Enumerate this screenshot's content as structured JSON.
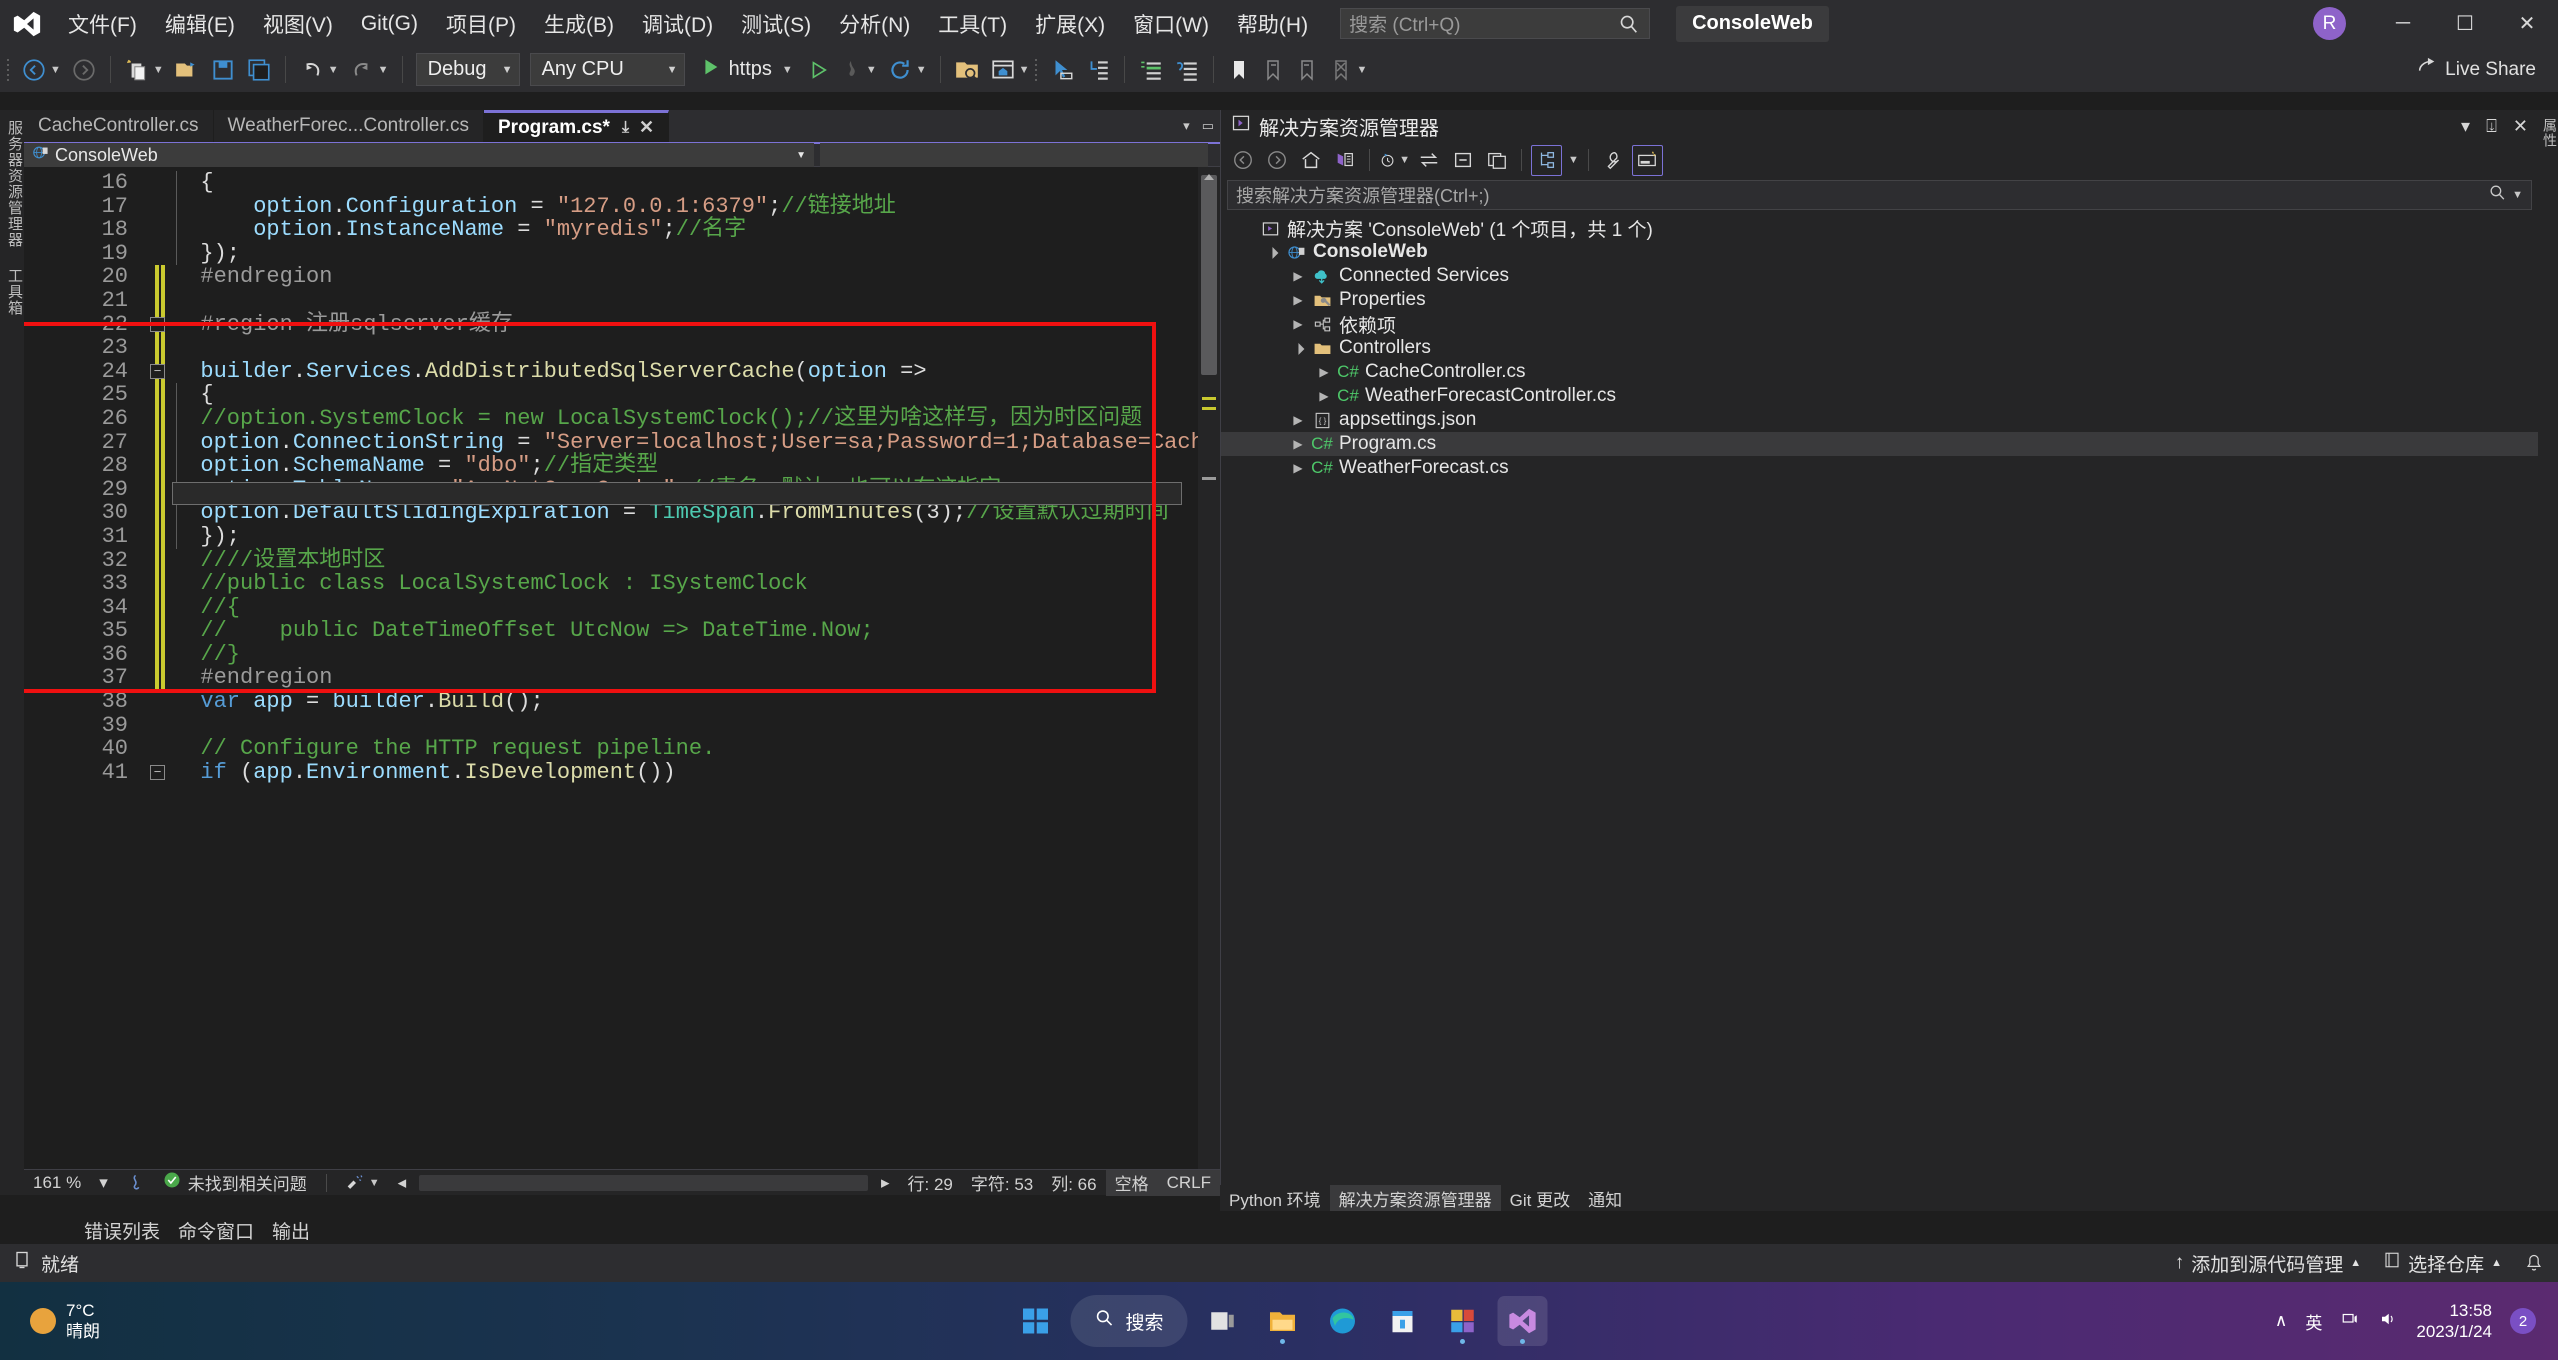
{
  "window": {
    "product_chip": "ConsoleWeb",
    "avatar_initial": "R",
    "minimize": "─",
    "maximize": "☐",
    "close": "✕"
  },
  "menu": {
    "items": [
      {
        "label": "文件(F)"
      },
      {
        "label": "编辑(E)"
      },
      {
        "label": "视图(V)"
      },
      {
        "label": "Git(G)"
      },
      {
        "label": "项目(P)"
      },
      {
        "label": "生成(B)"
      },
      {
        "label": "调试(D)"
      },
      {
        "label": "测试(S)"
      },
      {
        "label": "分析(N)"
      },
      {
        "label": "工具(T)"
      },
      {
        "label": "扩展(X)"
      },
      {
        "label": "窗口(W)"
      },
      {
        "label": "帮助(H)"
      }
    ],
    "search_placeholder": "搜索 (Ctrl+Q)"
  },
  "toolbar": {
    "config": "Debug",
    "platform": "Any CPU",
    "run_label": "https",
    "live_share": "Live Share"
  },
  "editor": {
    "tabs": [
      {
        "label": "CacheController.cs",
        "active": false
      },
      {
        "label": "WeatherForec...Controller.cs",
        "active": false
      },
      {
        "label": "Program.cs*",
        "active": true
      }
    ],
    "tab_pin": "⤓",
    "tab_close": "✕",
    "nav_project": "ConsoleWeb",
    "nav_member": "",
    "first_line": 16,
    "lines": [
      {
        "n": 16,
        "html": "<span class=\"pln\">  {</span>"
      },
      {
        "n": 17,
        "html": "<span class=\"pln\">      </span><span class=\"id2\">option</span><span class=\"pln\">.</span><span class=\"id2\">Configuration</span><span class=\"pln\"> = </span><span class=\"str\">\"127.0.0.1:6379\"</span><span class=\"pln\">;</span><span class=\"cmt\">//链接地址</span>"
      },
      {
        "n": 18,
        "html": "<span class=\"pln\">      </span><span class=\"id2\">option</span><span class=\"pln\">.</span><span class=\"id2\">InstanceName</span><span class=\"pln\"> = </span><span class=\"str\">\"myredis\"</span><span class=\"pln\">;</span><span class=\"cmt\">//名字</span>"
      },
      {
        "n": 19,
        "html": "<span class=\"pln\">  });</span>"
      },
      {
        "n": 20,
        "html": "<span class=\"pp\">  #endregion</span>"
      },
      {
        "n": 21,
        "html": ""
      },
      {
        "n": 22,
        "html": "<span class=\"pp\">  #region 注册sqlserver缓存</span>"
      },
      {
        "n": 23,
        "html": ""
      },
      {
        "n": 24,
        "html": "<span class=\"id2\">  builder</span><span class=\"pln\">.</span><span class=\"id2\">Services</span><span class=\"pln\">.</span><span class=\"mth\">AddDistributedSqlServerCache</span><span class=\"pln\">(</span><span class=\"id2\">option</span><span class=\"pln\"> =&gt;</span>"
      },
      {
        "n": 25,
        "html": "<span class=\"pln\">  {</span>"
      },
      {
        "n": 26,
        "html": "<span class=\"cmt\">  //option.SystemClock = new LocalSystemClock();//这里为啥这样写，因为时区问题</span>"
      },
      {
        "n": 27,
        "html": "<span class=\"id2\">  option</span><span class=\"pln\">.</span><span class=\"id2\">ConnectionString</span><span class=\"pln\"> = </span><span class=\"str\">\"Server=localhost;User=sa;Password=1;Database=CacheDB;Encrypt=True;TrustServerC</span>"
      },
      {
        "n": 28,
        "html": "<span class=\"id2\">  option</span><span class=\"pln\">.</span><span class=\"id2\">SchemaName</span><span class=\"pln\"> = </span><span class=\"str\">\"dbo\"</span><span class=\"pln\">;</span><span class=\"cmt\">//指定类型</span>"
      },
      {
        "n": 29,
        "html": "<span class=\"id2\">  option</span><span class=\"pln\">.</span><span class=\"id2\">TableName</span><span class=\"pln\"> = </span><span class=\"str\">\"AspNetCoreCache\"</span><span class=\"pln\">;</span><span class=\"cmt\">//表名，默认，也可以在这指定</span>"
      },
      {
        "n": 30,
        "html": "<span class=\"id2\">  option</span><span class=\"pln\">.</span><span class=\"id2\">DefaultSlidingExpiration</span><span class=\"pln\"> = </span><span class=\"typ\">TimeSpan</span><span class=\"pln\">.</span><span class=\"mth\">FromMinutes</span><span class=\"pln\">(3);</span><span class=\"cmt\">//设置默认过期时间</span>"
      },
      {
        "n": 31,
        "html": "<span class=\"pln\">  });</span>"
      },
      {
        "n": 32,
        "html": "<span class=\"cmt\">  ////设置本地时区</span>"
      },
      {
        "n": 33,
        "html": "<span class=\"cmt\">  //public class LocalSystemClock : ISystemClock</span>"
      },
      {
        "n": 34,
        "html": "<span class=\"cmt\">  //{</span>"
      },
      {
        "n": 35,
        "html": "<span class=\"cmt\">  //    public DateTimeOffset UtcNow =&gt; DateTime.Now;</span>"
      },
      {
        "n": 36,
        "html": "<span class=\"cmt\">  //}</span>"
      },
      {
        "n": 37,
        "html": "<span class=\"pp\">  #endregion</span>"
      },
      {
        "n": 38,
        "html": "<span class=\"pln\">  </span><span class=\"kw\">var</span><span class=\"pln\"> </span><span class=\"id2\">app</span><span class=\"pln\"> = </span><span class=\"id2\">builder</span><span class=\"pln\">.</span><span class=\"mth\">Build</span><span class=\"pln\">();</span>"
      },
      {
        "n": 39,
        "html": ""
      },
      {
        "n": 40,
        "html": "<span class=\"cmt\">  // Configure the HTTP request pipeline.</span>"
      },
      {
        "n": 41,
        "html": "<span class=\"pln\">  </span><span class=\"kw\">if</span><span class=\"pln\"> (</span><span class=\"id2\">app</span><span class=\"pln\">.</span><span class=\"id2\">Environment</span><span class=\"pln\">.</span><span class=\"mth\">IsDevelopment</span><span class=\"pln\">())</span>"
      }
    ],
    "status": {
      "zoom": "161 %",
      "issues": "未找到相关问题",
      "line": "行: 29",
      "chars": "字符: 53",
      "col": "列: 66",
      "spaces": "空格",
      "eol": "CRLF"
    }
  },
  "solution_explorer": {
    "title": "解决方案资源管理器",
    "search_placeholder": "搜索解决方案资源管理器(Ctrl+;)",
    "tree": [
      {
        "indent": 0,
        "twisty": "",
        "icon": "solution-icon",
        "label": "解决方案 'ConsoleWeb' (1 个项目，共 1 个)",
        "bold": false,
        "selected": false
      },
      {
        "indent": 1,
        "twisty": "▲",
        "icon": "web-project-icon",
        "label": "ConsoleWeb",
        "bold": true,
        "selected": false
      },
      {
        "indent": 2,
        "twisty": "▶",
        "icon": "connected-services-icon",
        "label": "Connected Services",
        "bold": false,
        "selected": false
      },
      {
        "indent": 2,
        "twisty": "▶",
        "icon": "properties-folder-icon",
        "label": "Properties",
        "bold": false,
        "selected": false
      },
      {
        "indent": 2,
        "twisty": "▶",
        "icon": "dependencies-icon",
        "label": "依赖项",
        "bold": false,
        "selected": false
      },
      {
        "indent": 2,
        "twisty": "▲",
        "icon": "folder-icon",
        "label": "Controllers",
        "bold": false,
        "selected": false
      },
      {
        "indent": 3,
        "twisty": "▶",
        "icon": "csharp-icon",
        "label": "CacheController.cs",
        "bold": false,
        "selected": false
      },
      {
        "indent": 3,
        "twisty": "▶",
        "icon": "csharp-icon",
        "label": "WeatherForecastController.cs",
        "bold": false,
        "selected": false
      },
      {
        "indent": 2,
        "twisty": "▶",
        "icon": "json-icon",
        "label": "appsettings.json",
        "bold": false,
        "selected": false
      },
      {
        "indent": 2,
        "twisty": "▶",
        "icon": "csharp-icon",
        "label": "Program.cs",
        "bold": false,
        "selected": true
      },
      {
        "indent": 2,
        "twisty": "▶",
        "icon": "csharp-icon",
        "label": "WeatherForecast.cs",
        "bold": false,
        "selected": false
      }
    ]
  },
  "right_rail": {
    "label": "属性"
  },
  "left_rail": {
    "labels": [
      "服务器资源管理器",
      "工具箱"
    ]
  },
  "bottom_tool_tabs": [
    {
      "label": "Python 环境",
      "selected": false
    },
    {
      "label": "解决方案资源管理器",
      "selected": true
    },
    {
      "label": "Git 更改",
      "selected": false
    },
    {
      "label": "通知",
      "selected": false
    }
  ],
  "bottom_panel_tabs": [
    {
      "label": "错误列表"
    },
    {
      "label": "命令窗口"
    },
    {
      "label": "输出"
    }
  ],
  "vs_status": {
    "ready": "就绪",
    "add_to_source_control": "添加到源代码管理",
    "select_repo": "选择仓库"
  },
  "taskbar": {
    "weather_temp": "7°C",
    "weather_desc": "晴朗",
    "search_label": "搜索",
    "lang": "英",
    "time": "13:58",
    "date": "2023/1/24",
    "notify_count": "2"
  },
  "colors": {
    "accent": "#7c72d6",
    "redbox": "#f01010",
    "changebar": "#caca2f",
    "string": "#d69d85",
    "comment": "#57a64a",
    "identifier": "#9cdcfe"
  }
}
